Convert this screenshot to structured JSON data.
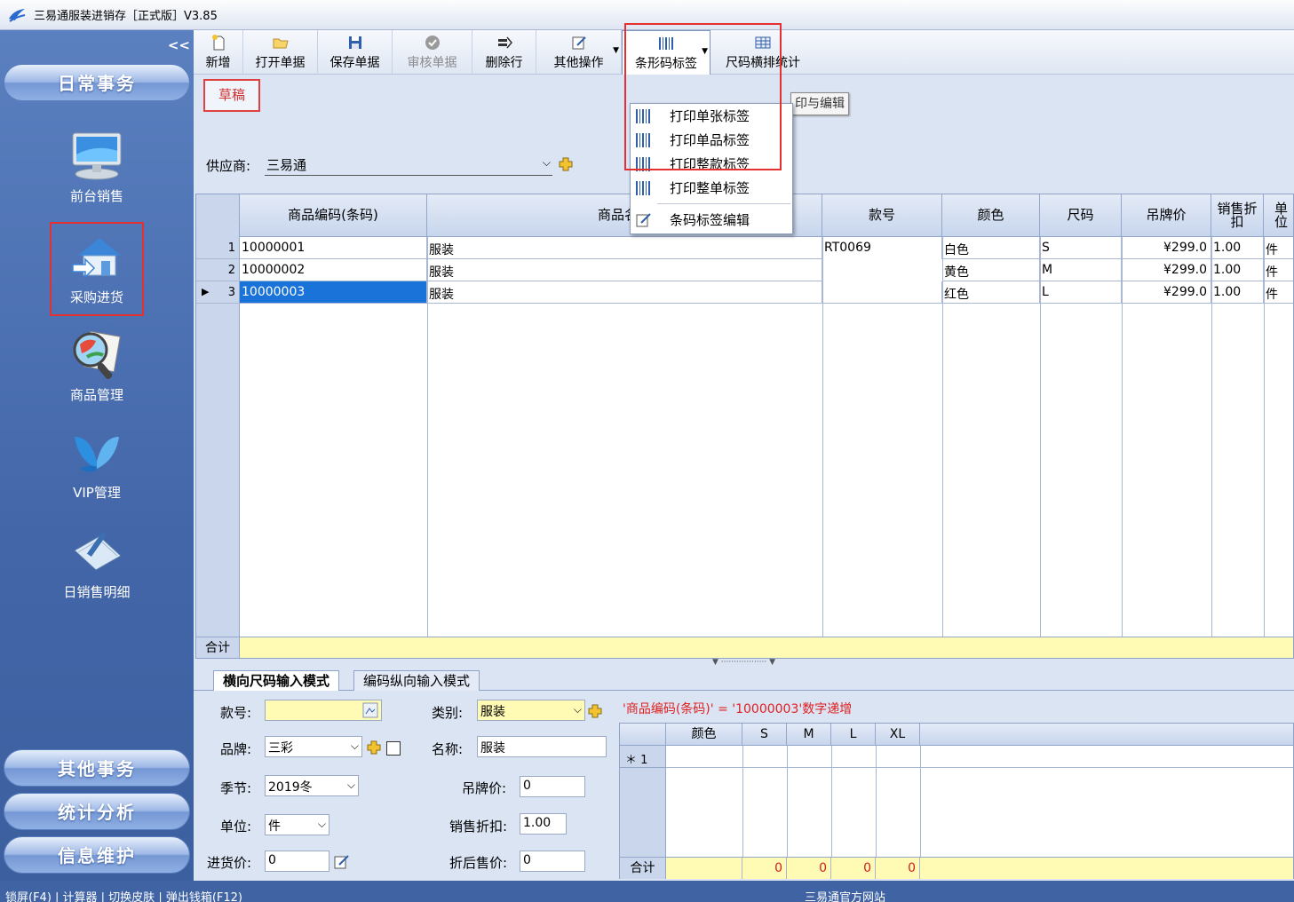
{
  "window": {
    "title": "三易通服装进销存［正式版］V3.85"
  },
  "sidebar": {
    "collapse_label": "<<",
    "top_category": "日常事务",
    "items": [
      {
        "label": "前台销售",
        "icon": "pos-monitor-icon"
      },
      {
        "label": "采购进货",
        "icon": "house-purchase-icon",
        "active": true
      },
      {
        "label": "商品管理",
        "icon": "magnifier-catalog-icon"
      },
      {
        "label": "VIP管理",
        "icon": "butterfly-icon"
      },
      {
        "label": "日销售明细",
        "icon": "notebook-pen-icon"
      }
    ],
    "bottom_categories": [
      "其他事务",
      "统计分析",
      "信息维护"
    ]
  },
  "toolbar": {
    "new": "新增",
    "open": "打开单据",
    "save": "保存单据",
    "audit": "审核单据",
    "delete_row": "删除行",
    "other_ops": "其他操作",
    "barcode_label": "条形码标签",
    "size_stats": "尺码横排统计"
  },
  "barcode_menu": {
    "items": [
      "打印单张标签",
      "打印单品标签",
      "打印整款标签",
      "打印整单标签"
    ],
    "edit_item": "条码标签编辑"
  },
  "tooltip_fragment": "印与编辑",
  "status": {
    "draft": "草稿"
  },
  "supplier": {
    "label": "供应商:",
    "value": "三易通"
  },
  "grid": {
    "columns": [
      "商品编码(条码)",
      "商品名称",
      "款号",
      "颜色",
      "尺码",
      "吊牌价",
      "销售折扣",
      "单位"
    ],
    "rows": [
      {
        "no": "1",
        "code": "10000001",
        "name": "服装",
        "style": "RT0069",
        "color": "白色",
        "size": "S",
        "price": "¥299.0",
        "discount": "1.00",
        "unit": "件"
      },
      {
        "no": "2",
        "code": "10000002",
        "name": "服装",
        "style": "",
        "color": "黄色",
        "size": "M",
        "price": "¥299.0",
        "discount": "1.00",
        "unit": "件"
      },
      {
        "no": "3",
        "code": "10000003",
        "name": "服装",
        "style": "",
        "color": "红色",
        "size": "L",
        "price": "¥299.0",
        "discount": "1.00",
        "unit": "件"
      }
    ],
    "total_label": "合计"
  },
  "tabs": [
    "横向尺码输入模式",
    "编码纵向输入模式"
  ],
  "form": {
    "style_label": "款号:",
    "style_value": "",
    "category_label": "类别:",
    "category_value": "服装",
    "brand_label": "品牌:",
    "brand_value": "三彩",
    "name_label": "名称:",
    "name_value": "服装",
    "season_label": "季节:",
    "season_value": "2019冬",
    "tag_price_label": "吊牌价:",
    "tag_price_value": "0",
    "unit_label": "单位:",
    "unit_value": "件",
    "discount_label": "销售折扣:",
    "discount_value": "1.00",
    "cost_label": "进货价:",
    "cost_value": "0",
    "net_price_label": "折后售价:",
    "net_price_value": "0"
  },
  "note": "'商品编码(条码)' = '10000003'数字递增",
  "size_grid": {
    "columns": [
      "颜色",
      "S",
      "M",
      "L",
      "XL"
    ],
    "new_row_marker": "＊ 1",
    "total_label": "合计",
    "totals": [
      "0",
      "0",
      "0",
      "0"
    ]
  },
  "statusbar": {
    "left": "锁屏(F4) | 计算器 | 切换皮肤 | 弹出钱箱(F12)",
    "center": "三易通官方网站"
  },
  "colors": {
    "accent_red": "#e53030",
    "selection_blue": "#1a73d8",
    "sidebar_blue": "#4266a8",
    "total_yellow": "#fffbb5"
  }
}
